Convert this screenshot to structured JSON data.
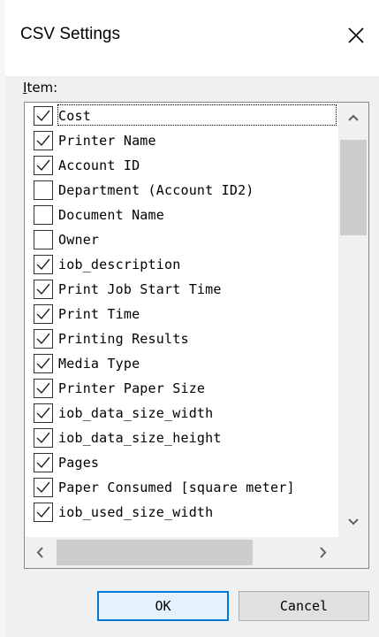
{
  "dialog": {
    "title": "CSV Settings"
  },
  "list": {
    "label_accel": "I",
    "label_rest": "tem:",
    "items": [
      {
        "label": "Cost",
        "checked": true
      },
      {
        "label": "Printer Name",
        "checked": true
      },
      {
        "label": "Account ID",
        "checked": true
      },
      {
        "label": "Department (Account ID2)",
        "checked": false
      },
      {
        "label": "Document Name",
        "checked": false
      },
      {
        "label": "Owner",
        "checked": false
      },
      {
        "label": "iob_description",
        "checked": true
      },
      {
        "label": "Print Job Start Time",
        "checked": true
      },
      {
        "label": "Print Time",
        "checked": true
      },
      {
        "label": "Printing Results",
        "checked": true
      },
      {
        "label": "Media Type",
        "checked": true
      },
      {
        "label": "Printer Paper Size",
        "checked": true
      },
      {
        "label": "iob_data_size_width",
        "checked": true
      },
      {
        "label": "iob_data_size_height",
        "checked": true
      },
      {
        "label": "Pages",
        "checked": true
      },
      {
        "label": "Paper Consumed [square meter]",
        "checked": true
      },
      {
        "label": "iob_used_size_width",
        "checked": true
      }
    ]
  },
  "buttons": {
    "ok": "OK",
    "cancel": "Cancel"
  },
  "icons": {
    "close": "close-icon",
    "check": "checkmark-icon",
    "scroll_up": "chevron-up-icon",
    "scroll_down": "chevron-down-icon",
    "scroll_left": "chevron-left-icon",
    "scroll_right": "chevron-right-icon"
  },
  "colors": {
    "default_button_border": "#0078d7",
    "list_border": "#828790",
    "scroll_thumb": "#cdcdcd"
  }
}
